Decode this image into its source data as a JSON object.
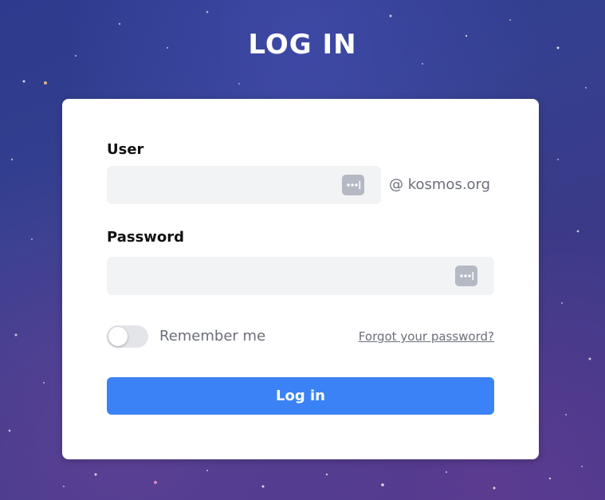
{
  "page": {
    "title": "LOG IN"
  },
  "form": {
    "user": {
      "label": "User",
      "value": "",
      "placeholder": "",
      "domain_suffix": "@ kosmos.org",
      "icon": "password-manager-key-icon"
    },
    "password": {
      "label": "Password",
      "value": "",
      "placeholder": "",
      "icon": "password-manager-key-icon"
    },
    "remember": {
      "label": "Remember me",
      "checked": false
    },
    "forgot_link": "Forgot your password?",
    "submit_label": "Log in"
  },
  "colors": {
    "accent": "#3b82f6",
    "card_background": "#ffffff",
    "input_background": "#f2f3f5",
    "background_top": "#2d3b8e",
    "background_bottom": "#4b3a8c"
  }
}
